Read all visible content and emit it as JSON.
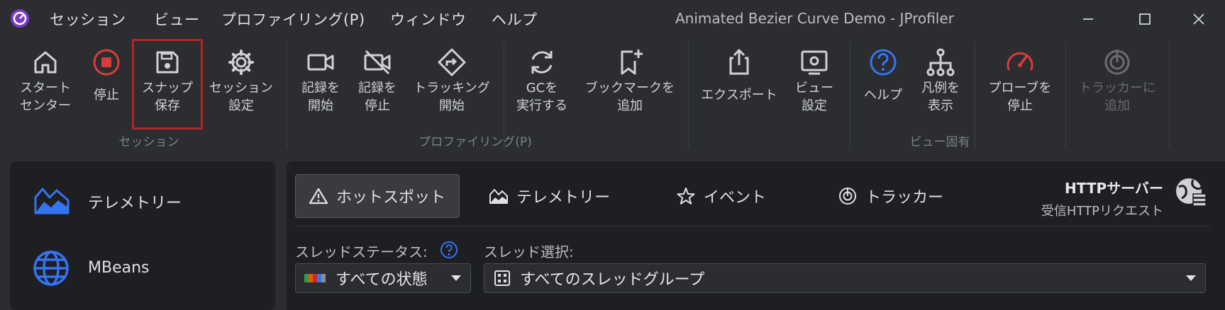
{
  "app_logo": "jprofiler-logo-icon",
  "menu": [
    "セッション",
    "ビュー",
    "プロファイリング(P)",
    "ウィンドウ",
    "ヘルプ"
  ],
  "window_title": "Animated Bezier Curve Demo - JProfiler",
  "toolbar": {
    "start_center": {
      "line1": "スタート",
      "line2": "センター",
      "icon": "home-icon"
    },
    "stop": {
      "line1": "停止",
      "icon": "stop-icon"
    },
    "snapshot_save": {
      "line1": "スナップ",
      "line2": "保存",
      "icon": "floppy-icon"
    },
    "session_settings": {
      "line1": "セッション",
      "line2": "設定",
      "icon": "gear-icon"
    },
    "record_start": {
      "line1": "記録を",
      "line2": "開始",
      "icon": "video-camera-icon"
    },
    "record_stop": {
      "line1": "記録を",
      "line2": "停止",
      "icon": "video-camera-off-icon"
    },
    "tracking_start": {
      "line1": "トラッキング",
      "line2": "開始",
      "icon": "tracking-icon"
    },
    "run_gc": {
      "line1": "GCを",
      "line2": "実行する",
      "icon": "refresh-icon"
    },
    "add_bookmark": {
      "line1": "ブックマークを",
      "line2": "追加",
      "icon": "bookmark-add-icon"
    },
    "export": {
      "line1": "エクスポート",
      "icon": "export-icon"
    },
    "view_settings": {
      "line1": "ビュー",
      "line2": "設定",
      "icon": "view-settings-icon"
    },
    "help": {
      "line1": "ヘルプ",
      "icon": "help-icon"
    },
    "legend": {
      "line1": "凡例を",
      "line2": "表示",
      "icon": "hierarchy-icon"
    },
    "stop_probe": {
      "line1": "プローブを",
      "line2": "停止",
      "icon": "gauge-icon"
    },
    "add_tracker": {
      "line1": "トラッカーに",
      "line2": "追加",
      "icon": "tracker-icon"
    },
    "groups": {
      "session": "セッション",
      "profiling": "プロファイリング(P)",
      "view_specific": "ビュー固有"
    }
  },
  "left_nav": [
    {
      "label": "テレメトリー",
      "icon": "telemetry-icon"
    },
    {
      "label": "MBeans",
      "icon": "globe-icon"
    }
  ],
  "tabs": [
    {
      "label": "ホットスポット",
      "icon": "warning-icon",
      "selected": true
    },
    {
      "label": "テレメトリー",
      "icon": "telemetry-icon"
    },
    {
      "label": "イベント",
      "icon": "star-icon"
    },
    {
      "label": "トラッカー",
      "icon": "tracker-icon"
    }
  ],
  "probe_header": {
    "title": "HTTPサーバー",
    "subtitle": "受信HTTPリクエスト",
    "icon": "http-server-icon"
  },
  "filters": {
    "thread_status_label": "スレッドステータス:",
    "thread_status_value": "すべての状態",
    "thread_select_label": "スレッド選択:",
    "thread_select_value": "すべてのスレッドグループ"
  },
  "colors": {
    "accent_blue": "#3574f0",
    "stop_red": "#db3b3b",
    "highlight_red": "#b32424"
  }
}
